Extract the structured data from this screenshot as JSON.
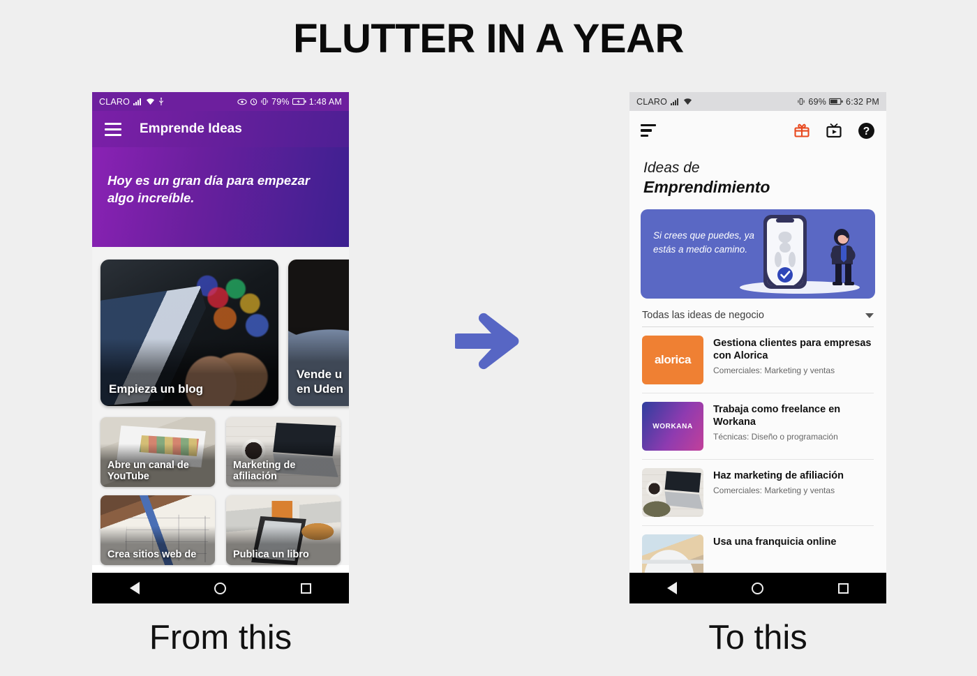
{
  "headline": "FLUTTER IN A YEAR",
  "captions": {
    "left": "From this",
    "right": "To this"
  },
  "arrow": {
    "name": "right-arrow",
    "color": "#5766c4"
  },
  "left_phone": {
    "statusbar": {
      "carrier": "CLARO",
      "battery": "79%",
      "time": "1:48 AM",
      "icons": [
        "signal-icon",
        "wifi-icon",
        "usb-icon",
        "eye-icon",
        "alarm-icon",
        "vibrate-icon",
        "battery-icon"
      ]
    },
    "appbar": {
      "menu_icon": "hamburger-icon",
      "title": "Emprende Ideas"
    },
    "hero": {
      "text": "Hoy es un gran día para empezar algo increíble."
    },
    "featured": [
      {
        "label": "Empieza un blog"
      },
      {
        "label": "Vende u\nen Uden"
      }
    ],
    "grid": [
      {
        "label": "Abre un canal de YouTube"
      },
      {
        "label": "Marketing de afiliación"
      },
      {
        "label": "Crea sitios web de"
      },
      {
        "label": "Publica un libro"
      }
    ],
    "navbar": [
      "back-icon",
      "home-icon",
      "recents-icon"
    ]
  },
  "right_phone": {
    "statusbar": {
      "carrier": "CLARO",
      "battery": "69%",
      "time": "6:32 PM",
      "icons": [
        "signal-icon",
        "wifi-icon",
        "vibrate-icon",
        "battery-icon"
      ]
    },
    "appbar": {
      "menu_icon": "sort-lines-icon",
      "actions": [
        "gift-icon",
        "tv-icon",
        "help-icon"
      ]
    },
    "title": {
      "line1": "Ideas de",
      "line2": "Emprendimiento"
    },
    "banner": {
      "text": "Si crees que puedes, ya estás a medio camino.",
      "color": "#5a68c4",
      "illustration": "phone-and-woman-illustration"
    },
    "filter": {
      "value": "Todas las ideas de negocio",
      "icon": "chevron-down-icon"
    },
    "list": [
      {
        "title": "Gestiona clientes para empresas con Alorica",
        "subtitle": "Comerciales: Marketing y ventas",
        "thumb": "alorica-logo",
        "thumb_color": "#ef8033",
        "thumb_text": "alorica"
      },
      {
        "title": "Trabaja como freelance en Workana",
        "subtitle": "Técnicas: Diseño o programación",
        "thumb": "workana-logo",
        "thumb_color": "#8e3bb0",
        "thumb_text": "WORKANA"
      },
      {
        "title": "Haz marketing de afiliación",
        "subtitle": "Comerciales: Marketing y ventas",
        "thumb": "laptop-new-product-photo",
        "thumb_color": "#d8d4cd",
        "thumb_text": ""
      },
      {
        "title": "Usa una franquicia online",
        "subtitle": "",
        "thumb": "coffee-cup-photo",
        "thumb_color": "#cfd8dd",
        "thumb_text": ""
      }
    ],
    "navbar": [
      "back-icon",
      "home-icon",
      "recents-icon"
    ]
  }
}
